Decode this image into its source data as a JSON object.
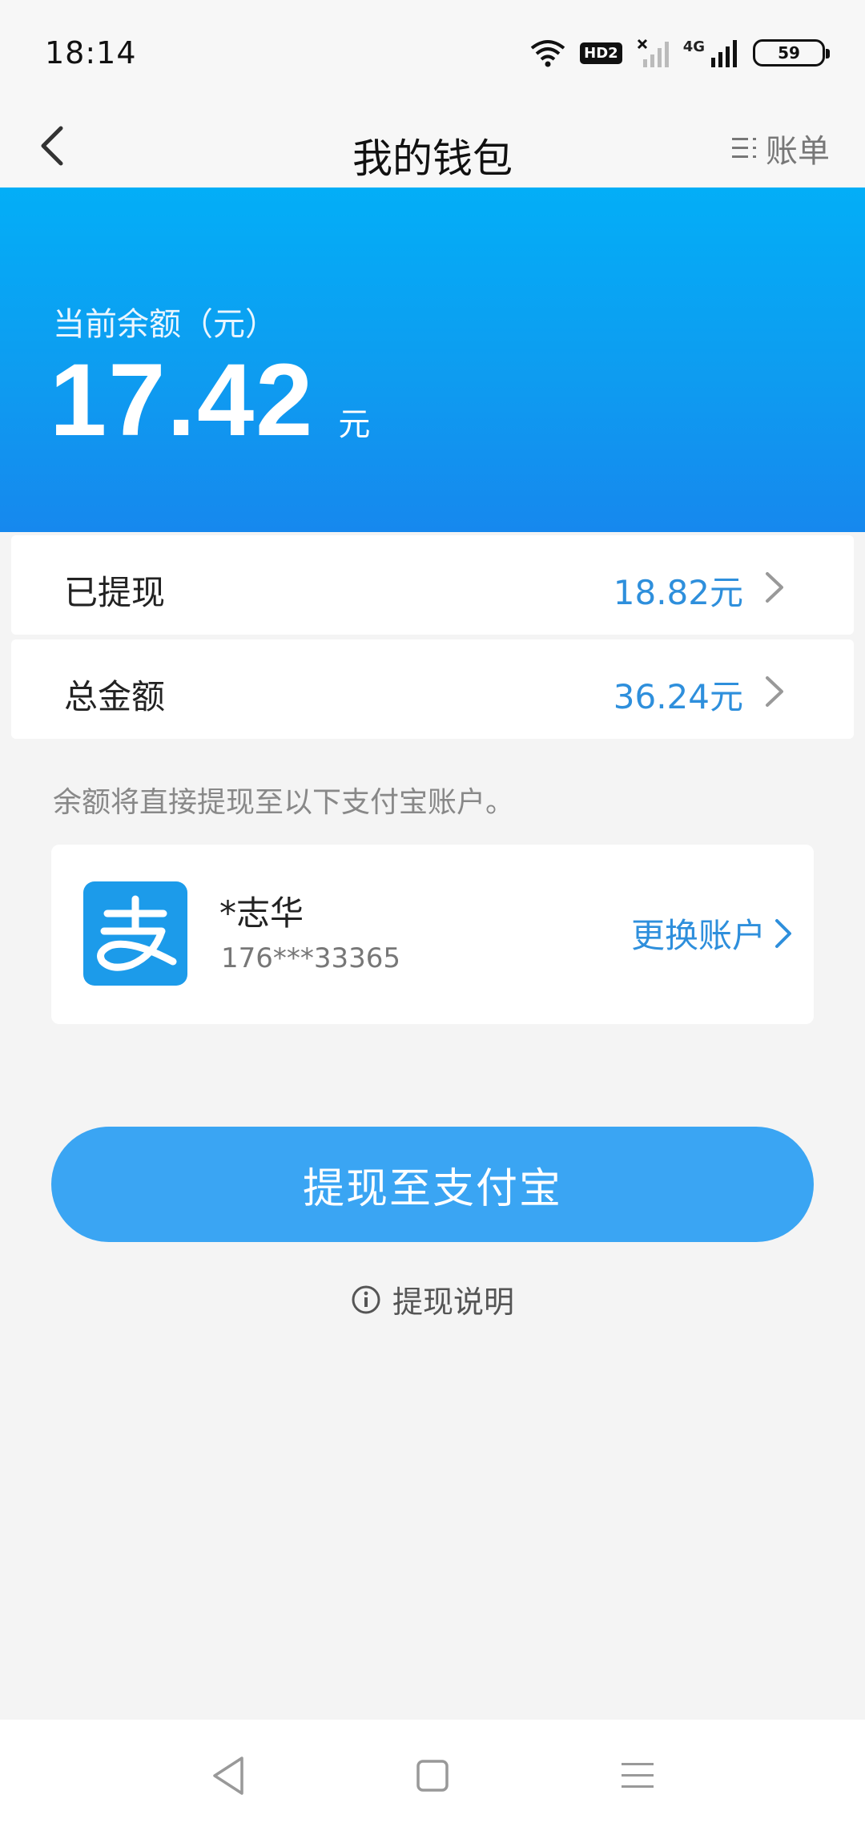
{
  "status_bar": {
    "time": "18:14",
    "hd_label": "HD2",
    "network_label": "4G",
    "battery": "59"
  },
  "nav": {
    "title": "我的钱包",
    "bill_label": "账单"
  },
  "hero": {
    "balance_label": "当前余额（元）",
    "balance_value": "17.42",
    "balance_unit": "元"
  },
  "rows": [
    {
      "label": "已提现",
      "value": "18.82元"
    },
    {
      "label": "总金额",
      "value": "36.24元"
    }
  ],
  "hint": "余额将直接提现至以下支付宝账户。",
  "account": {
    "name": "*志华",
    "phone": "176***33365",
    "change_label": "更换账户"
  },
  "withdraw_button": "提现至支付宝",
  "explain_link": "提现说明",
  "colors": {
    "accent_blue": "#2e8fdc",
    "button_blue": "#3aa5f3",
    "hero_top": "#03aef7",
    "hero_bottom": "#1688ee",
    "alipay_blue": "#1c9bea"
  }
}
